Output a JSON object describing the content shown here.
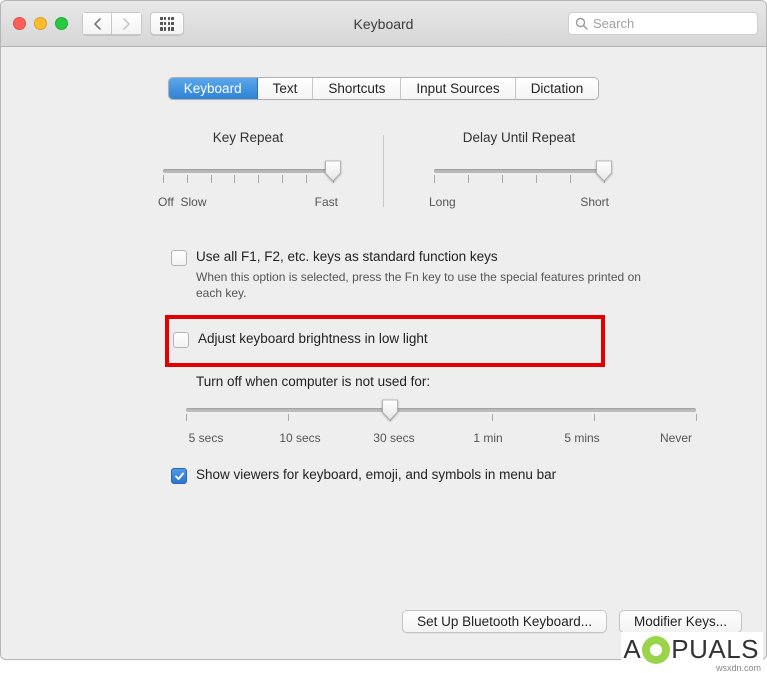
{
  "window": {
    "title": "Keyboard"
  },
  "toolbar": {
    "search_placeholder": "Search"
  },
  "tabs": {
    "keyboard": "Keyboard",
    "text": "Text",
    "shortcuts": "Shortcuts",
    "input_sources": "Input Sources",
    "dictation": "Dictation"
  },
  "sliders": {
    "key_repeat": {
      "title": "Key Repeat",
      "left_label": "Off",
      "left_label2": "Slow",
      "right_label": "Fast"
    },
    "delay": {
      "title": "Delay Until Repeat",
      "left_label": "Long",
      "right_label": "Short"
    },
    "idle_off": {
      "title": "Turn off when computer is not used for:",
      "labels": [
        "5 secs",
        "10 secs",
        "30 secs",
        "1 min",
        "5 mins",
        "Never"
      ]
    }
  },
  "options": {
    "fn_keys": {
      "label": "Use all F1, F2, etc. keys as standard function keys",
      "desc": "When this option is selected, press the Fn key to use the special features printed on each key."
    },
    "adjust_brightness": {
      "label": "Adjust keyboard brightness in low light"
    },
    "show_viewers": {
      "label": "Show viewers for keyboard, emoji, and symbols in menu bar"
    }
  },
  "buttons": {
    "bluetooth": "Set Up Bluetooth Keyboard...",
    "modifier": "Modifier Keys..."
  },
  "watermark": {
    "pre": "A",
    "post": "PUALS",
    "url": "wsxdn.com"
  }
}
